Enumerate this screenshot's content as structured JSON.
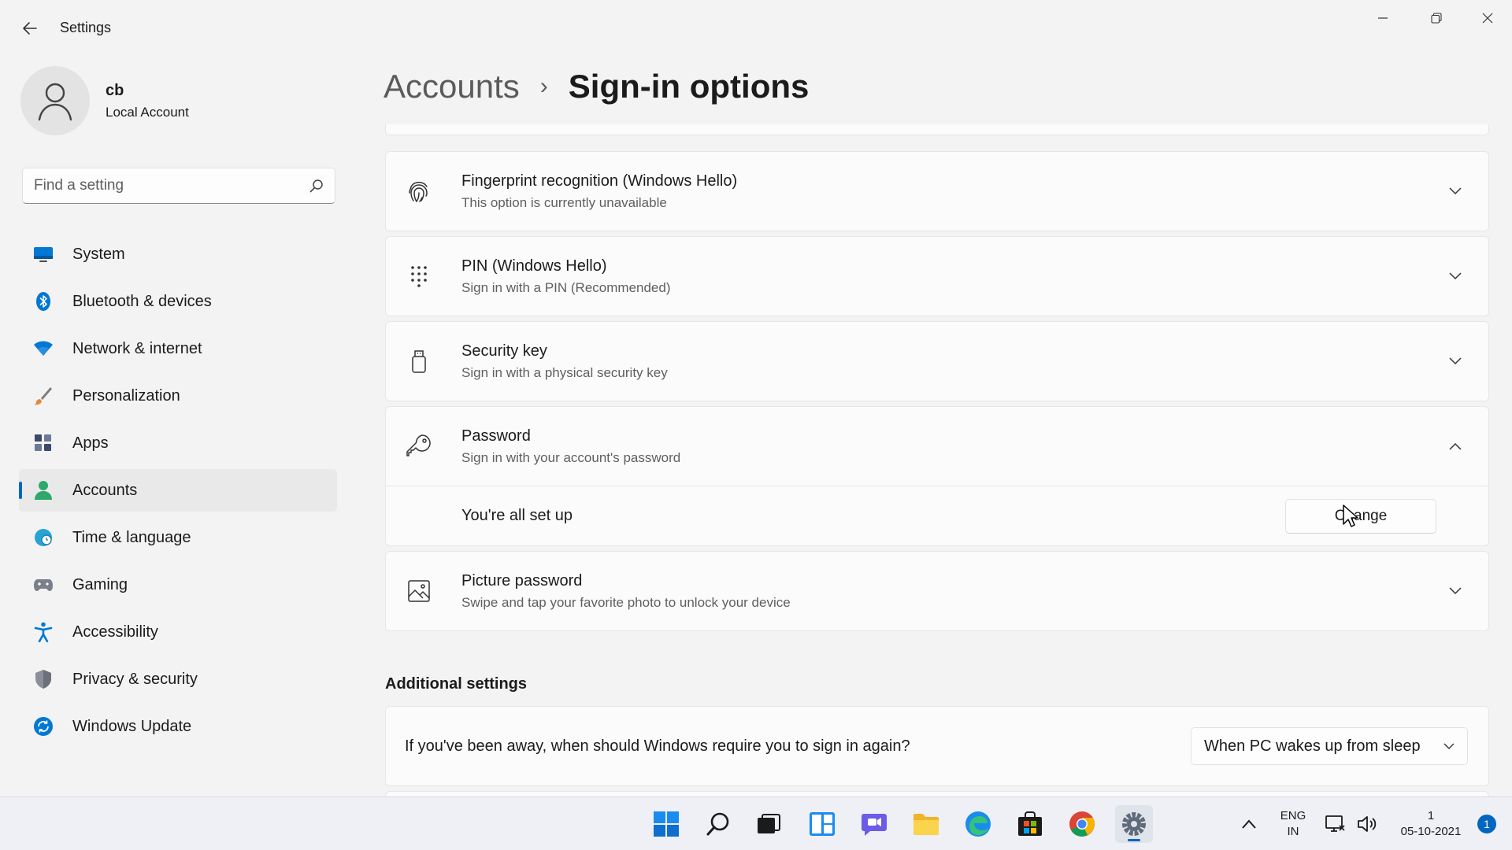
{
  "window": {
    "title": "Settings",
    "back_icon": "arrow-left-icon",
    "minimize_icon": "minimize-icon",
    "restore_icon": "restore-icon",
    "close_icon": "close-icon"
  },
  "profile": {
    "name": "cb",
    "account_type": "Local Account",
    "avatar_icon": "person-icon"
  },
  "search": {
    "placeholder": "Find a setting",
    "icon": "search-icon"
  },
  "nav": {
    "items": [
      {
        "label": "System",
        "icon": "system-icon",
        "active": false
      },
      {
        "label": "Bluetooth & devices",
        "icon": "bluetooth-icon",
        "active": false
      },
      {
        "label": "Network & internet",
        "icon": "wifi-icon",
        "active": false
      },
      {
        "label": "Personalization",
        "icon": "brush-icon",
        "active": false
      },
      {
        "label": "Apps",
        "icon": "apps-icon",
        "active": false
      },
      {
        "label": "Accounts",
        "icon": "accounts-icon",
        "active": true
      },
      {
        "label": "Time & language",
        "icon": "globe-clock-icon",
        "active": false
      },
      {
        "label": "Gaming",
        "icon": "gamepad-icon",
        "active": false
      },
      {
        "label": "Accessibility",
        "icon": "accessibility-icon",
        "active": false
      },
      {
        "label": "Privacy & security",
        "icon": "shield-icon",
        "active": false
      },
      {
        "label": "Windows Update",
        "icon": "update-icon",
        "active": false
      }
    ]
  },
  "breadcrumb": {
    "parent": "Accounts",
    "separator": "›",
    "current": "Sign-in options"
  },
  "signin_options": [
    {
      "title": "Fingerprint recognition (Windows Hello)",
      "subtitle": "This option is currently unavailable",
      "icon": "fingerprint-icon",
      "expanded": false
    },
    {
      "title": "PIN (Windows Hello)",
      "subtitle": "Sign in with a PIN (Recommended)",
      "icon": "pin-keypad-icon",
      "expanded": false
    },
    {
      "title": "Security key",
      "subtitle": "Sign in with a physical security key",
      "icon": "usb-key-icon",
      "expanded": false
    },
    {
      "title": "Password",
      "subtitle": "Sign in with your account's password",
      "icon": "key-icon",
      "expanded": true
    },
    {
      "title": "Picture password",
      "subtitle": "Swipe and tap your favorite photo to unlock your device",
      "icon": "picture-icon",
      "expanded": false
    }
  ],
  "password_expanded": {
    "status": "You're all set up",
    "button_label": "Change"
  },
  "additional": {
    "title": "Additional settings",
    "question": "If you've been away, when should Windows require you to sign in again?",
    "selected": "When PC wakes up from sleep"
  },
  "taskbar": {
    "apps": [
      "windows-start-icon",
      "search-icon",
      "task-view-icon",
      "widgets-icon",
      "chat-icon",
      "file-explorer-icon",
      "edge-icon",
      "store-icon",
      "chrome-icon",
      "settings-icon"
    ],
    "language_top": "ENG",
    "language_bottom": "IN",
    "clock_time": "1",
    "clock_date": "05-10-2021",
    "notification_count": "1"
  },
  "colors": {
    "accent": "#0067c0",
    "background": "#f3f3f3",
    "card": "#fbfbfb"
  }
}
